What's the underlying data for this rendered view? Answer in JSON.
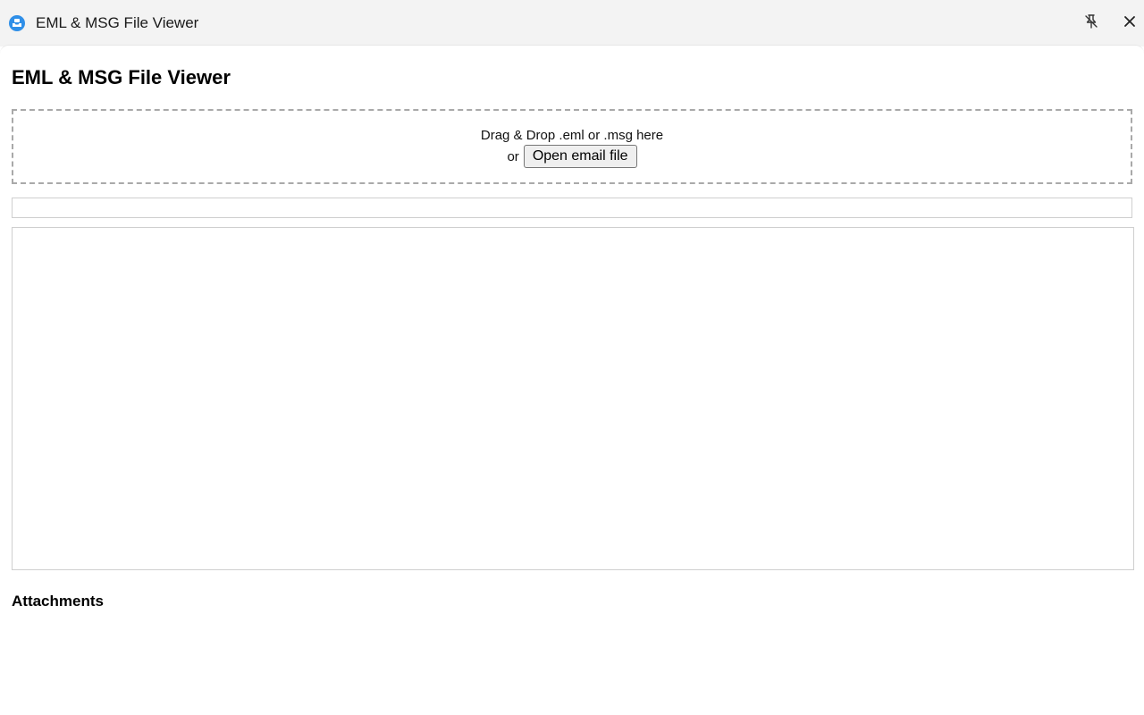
{
  "window": {
    "title": "EML & MSG File Viewer",
    "app_icon": "mail-app-icon",
    "controls": {
      "unpin_icon": "unpin-icon",
      "close_icon": "close-icon"
    }
  },
  "main": {
    "heading": "EML & MSG File Viewer",
    "dropzone": {
      "instruction": "Drag & Drop .eml or .msg here",
      "or_label": "or",
      "open_button_label": "Open email file"
    },
    "attachments_heading": "Attachments"
  },
  "colors": {
    "app_icon_blue": "#2f8fe8",
    "titlebar_bg": "#f3f3f3",
    "dropzone_border": "#a9a9a9",
    "panel_border": "#cfcfcf"
  }
}
